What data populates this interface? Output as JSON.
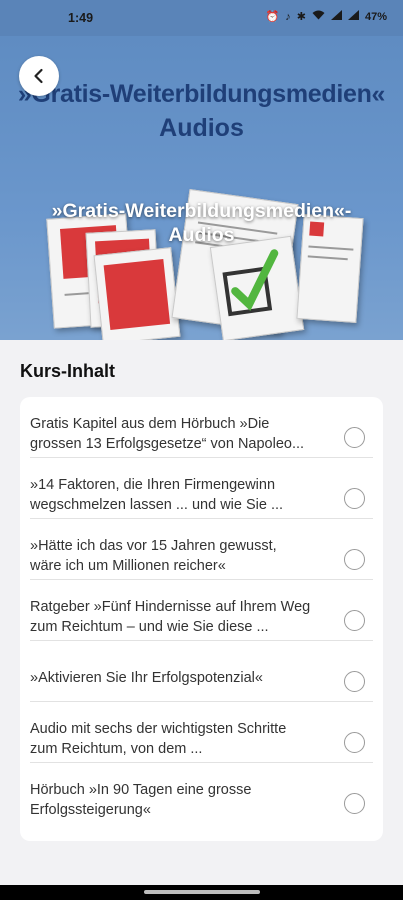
{
  "status_bar": {
    "time": "1:49",
    "battery": "47%",
    "icons": [
      "alarm-icon",
      "mute-icon",
      "bluetooth-icon",
      "wifi-icon",
      "signal-icon",
      "signal-icon"
    ]
  },
  "header": {
    "back_icon": "chevron-left-icon",
    "hero_title_line1": "»Gratis-Weiterbildungsmedien«",
    "hero_title_line2": "Audios",
    "overlay_title_line1": "»Gratis-Weiterbildungsmedien«-",
    "overlay_title_line2": "Audios"
  },
  "course": {
    "section_title": "Kurs-Inhalt",
    "items": [
      {
        "line1": "Gratis Kapitel aus dem Hörbuch »Die",
        "line2": "grossen 13 Erfolgsgesetze“ von Napoleo..."
      },
      {
        "line1": "»14 Faktoren, die Ihren Firmengewinn",
        "line2": "wegschmelzen lassen ... und wie Sie ..."
      },
      {
        "line1": "»Hätte ich das vor 15 Jahren gewusst,",
        "line2": "wäre ich um Millionen reicher«"
      },
      {
        "line1": "Ratgeber »Fünf Hindernisse auf Ihrem Weg",
        "line2": "zum Reichtum – und wie Sie diese ..."
      },
      {
        "line1": "»Aktivieren Sie Ihr Erfolgspotenzial«",
        "line2": ""
      },
      {
        "line1": "Audio mit sechs der wichtigsten Schritte",
        "line2": "zum Reichtum, von dem ..."
      },
      {
        "line1": "Hörbuch »In 90 Tagen eine grosse",
        "line2": "Erfolgssteigerung«"
      }
    ]
  }
}
